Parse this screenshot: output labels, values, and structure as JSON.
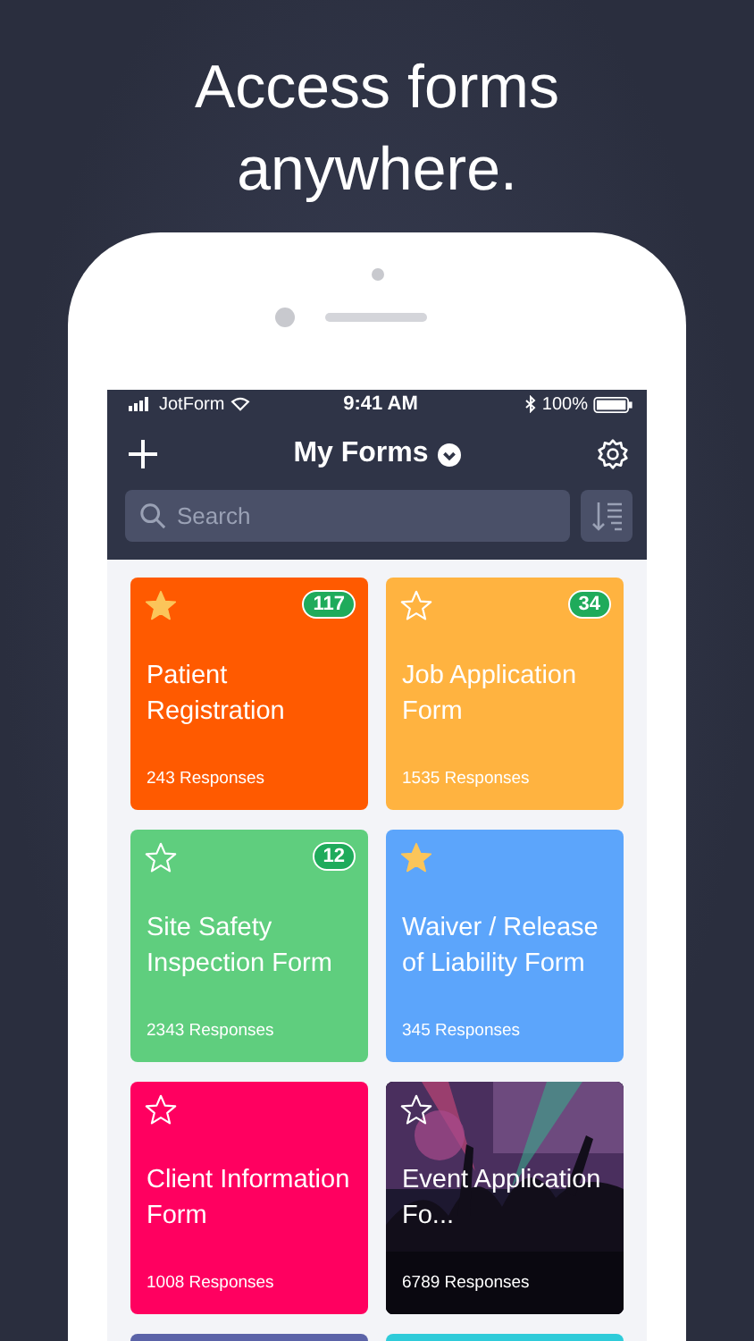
{
  "headline": "Access forms anywhere.",
  "status_bar": {
    "carrier": "JotForm",
    "time": "9:41 AM",
    "battery": "100%"
  },
  "header": {
    "title": "My Forms"
  },
  "search": {
    "placeholder": "Search"
  },
  "forms": [
    {
      "kind": "color",
      "title": "Patient Registration",
      "responses": "243 Responses",
      "starred": true,
      "badge": "117",
      "color": "#ff5a00"
    },
    {
      "kind": "color",
      "title": "Job Application Form",
      "responses": "1535 Responses",
      "starred": false,
      "badge": "34",
      "color": "#ffb340"
    },
    {
      "kind": "color",
      "title": "Site Safety Inspection Form",
      "responses": "2343 Responses",
      "starred": false,
      "badge": "12",
      "color": "#5fce7e"
    },
    {
      "kind": "color",
      "title": "Waiver / Release of Liability Form",
      "responses": "345 Responses",
      "starred": true,
      "color": "#5ca5fb"
    },
    {
      "kind": "color",
      "title": "Client Information Form",
      "responses": "1008 Responses",
      "starred": false,
      "color": "#ff0060"
    },
    {
      "kind": "picture",
      "title": "Event Application Fo...",
      "responses": "6789 Responses",
      "starred": false
    },
    {
      "kind": "color",
      "color": "#5b63a8"
    },
    {
      "kind": "color",
      "color": "#2ecbd9"
    }
  ]
}
